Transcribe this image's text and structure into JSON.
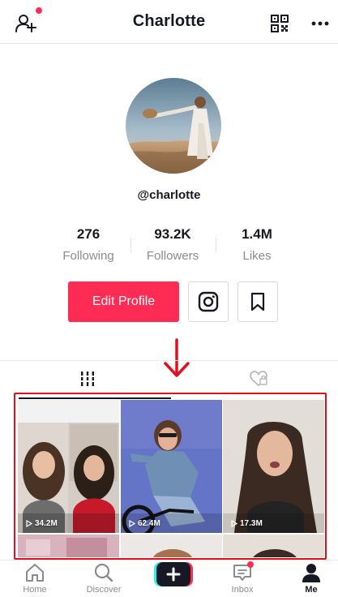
{
  "header": {
    "title": "Charlotte",
    "icons": [
      "add-friend-icon",
      "qr-code-icon",
      "more-icon"
    ],
    "notification_color": "#fe2c55"
  },
  "profile": {
    "handle": "@charlotte",
    "stats": [
      {
        "value": "276",
        "label": "Following"
      },
      {
        "value": "93.2K",
        "label": "Followers"
      },
      {
        "value": "1.4M",
        "label": "Likes"
      }
    ],
    "edit_label": "Edit Profile",
    "accent_color": "#fe2c55"
  },
  "tabs": [
    {
      "name": "videos",
      "icon": "videos-grid-icon",
      "active": true
    },
    {
      "name": "liked",
      "icon": "liked-heart-icon",
      "active": false
    }
  ],
  "videos": [
    {
      "views": "34.2M"
    },
    {
      "views": "62.4M"
    },
    {
      "views": "17.3M"
    }
  ],
  "bottom_nav": {
    "items": [
      {
        "label": "Home",
        "icon": "home-icon"
      },
      {
        "label": "Discover",
        "icon": "discover-icon"
      },
      {
        "label": "Inbox",
        "icon": "inbox-icon"
      },
      {
        "label": "Me",
        "icon": "me-icon",
        "active": true
      }
    ],
    "create_icon": "plus-icon"
  },
  "annotation": {
    "color": "#e0101e"
  }
}
